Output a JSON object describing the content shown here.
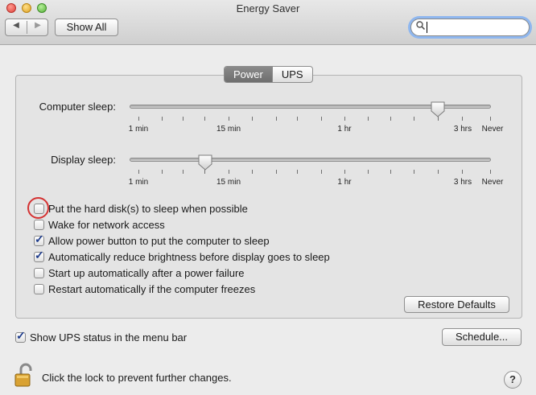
{
  "window": {
    "title": "Energy Saver"
  },
  "toolbar": {
    "back_icon": "◀",
    "forward_icon": "▶",
    "show_all_label": "Show All",
    "search_value": ""
  },
  "tabs": [
    {
      "label": "Power",
      "active": true
    },
    {
      "label": "UPS",
      "active": false
    }
  ],
  "sliders": {
    "computer": {
      "label": "Computer sleep:",
      "value": "3 hrs"
    },
    "display": {
      "label": "Display sleep:",
      "value": "10 min"
    },
    "tick_labels": [
      "1 min",
      "15 min",
      "1 hr",
      "3 hrs",
      "Never"
    ]
  },
  "options": [
    {
      "label": "Put the hard disk(s) to sleep when possible",
      "checked": false
    },
    {
      "label": "Wake for network access",
      "checked": false
    },
    {
      "label": "Allow power button to put the computer to sleep",
      "checked": true
    },
    {
      "label": "Automatically reduce brightness before display goes to sleep",
      "checked": true
    },
    {
      "label": "Start up automatically after a power failure",
      "checked": false
    },
    {
      "label": "Restart automatically if the computer freezes",
      "checked": false
    }
  ],
  "buttons": {
    "restore_defaults": "Restore Defaults",
    "schedule": "Schedule..."
  },
  "ups_status": {
    "label": "Show UPS status in the menu bar",
    "checked": true
  },
  "lock": {
    "text": "Click the lock to prevent further changes."
  },
  "help": {
    "label": "?"
  },
  "colors": {
    "accent": "#1e3c8c",
    "annotation": "#d43232"
  }
}
